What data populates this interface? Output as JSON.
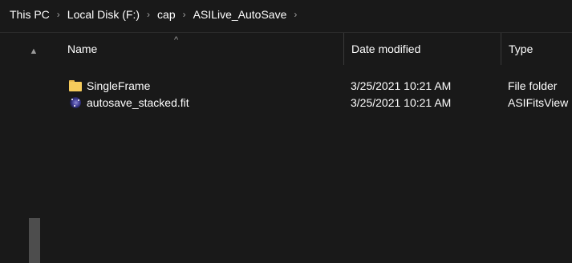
{
  "breadcrumb": {
    "items": [
      "This PC",
      "Local Disk (F:)",
      "cap",
      "ASILive_AutoSave"
    ],
    "separator": "›"
  },
  "columns": {
    "name": "Name",
    "date_modified": "Date modified",
    "type": "Type"
  },
  "files": [
    {
      "name": "SingleFrame",
      "date_modified": "3/25/2021 10:21 AM",
      "type": "File folder",
      "icon": "folder-icon"
    },
    {
      "name": "autosave_stacked.fit",
      "date_modified": "3/25/2021 10:21 AM",
      "type": "ASIFitsView",
      "icon": "fits-file-icon"
    }
  ],
  "colors": {
    "background": "#191919",
    "text": "#ffffff",
    "folder": "#f6cc5c"
  }
}
